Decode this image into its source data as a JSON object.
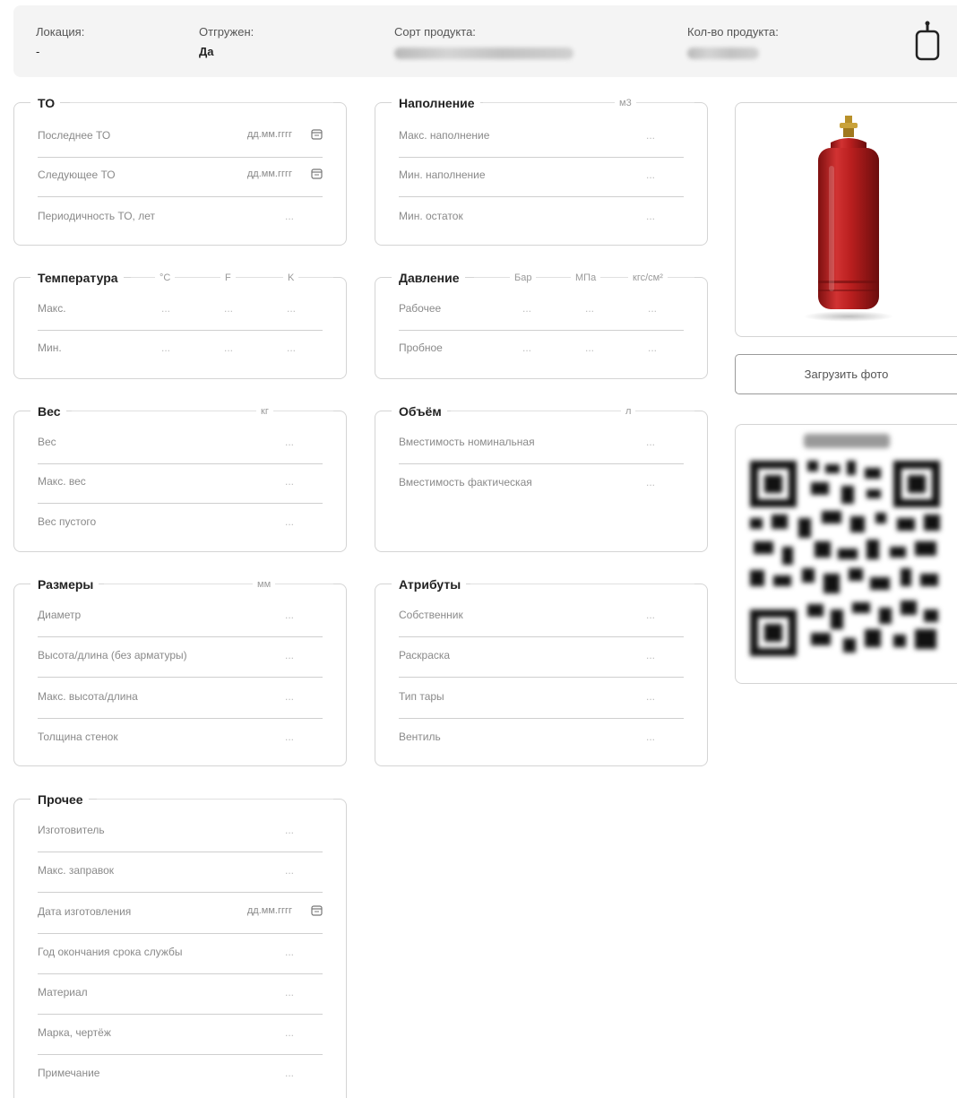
{
  "header": {
    "location_label": "Локация:",
    "location_value": "-",
    "shipped_label": "Отгружен:",
    "shipped_value": "Да",
    "grade_label": "Сорт продукта:",
    "qty_label": "Кол-во продукта:"
  },
  "panels": {
    "to": {
      "title": "ТО",
      "rows": [
        {
          "label": "Последнее ТО",
          "value": "дд.мм.гггг"
        },
        {
          "label": "Следующее ТО",
          "value": "дд.мм.гггг"
        },
        {
          "label": "Периодичность ТО, лет",
          "value": "..."
        }
      ]
    },
    "filling": {
      "title": "Наполнение",
      "unit": "м3",
      "rows": [
        {
          "label": "Макс. наполнение",
          "value": "..."
        },
        {
          "label": "Мин. наполнение",
          "value": "..."
        },
        {
          "label": "Мин. остаток",
          "value": "..."
        }
      ]
    },
    "temperature": {
      "title": "Температура",
      "units": [
        "°C",
        "F",
        "K"
      ],
      "rows": [
        {
          "label": "Макс.",
          "values": [
            "...",
            "...",
            "..."
          ]
        },
        {
          "label": "Мин.",
          "values": [
            "...",
            "...",
            "..."
          ]
        }
      ]
    },
    "pressure": {
      "title": "Давление",
      "units": [
        "Бар",
        "МПа",
        "кгс/см²"
      ],
      "rows": [
        {
          "label": "Рабочее",
          "values": [
            "...",
            "...",
            "..."
          ]
        },
        {
          "label": "Пробное",
          "values": [
            "...",
            "...",
            "..."
          ]
        }
      ]
    },
    "weight": {
      "title": "Вес",
      "unit": "кг",
      "rows": [
        {
          "label": "Вес",
          "value": "..."
        },
        {
          "label": "Макс. вес",
          "value": "..."
        },
        {
          "label": "Вес пустого",
          "value": "..."
        }
      ]
    },
    "volume": {
      "title": "Объём",
      "unit": "л",
      "rows": [
        {
          "label": "Вместимость номинальная",
          "value": "..."
        },
        {
          "label": "Вместимость фактическая",
          "value": "..."
        }
      ]
    },
    "dimensions": {
      "title": "Размеры",
      "unit": "мм",
      "rows": [
        {
          "label": "Диаметр",
          "value": "..."
        },
        {
          "label": "Высота/длина (без арматуры)",
          "value": "..."
        },
        {
          "label": "Макс. высота/длина",
          "value": "..."
        },
        {
          "label": "Толщина стенок",
          "value": "..."
        }
      ]
    },
    "attributes": {
      "title": "Атрибуты",
      "rows": [
        {
          "label": "Собственник",
          "value": "..."
        },
        {
          "label": "Раскраска",
          "value": "..."
        },
        {
          "label": "Тип тары",
          "value": "..."
        },
        {
          "label": "Вентиль",
          "value": "..."
        }
      ]
    },
    "other": {
      "title": "Прочее",
      "rows": [
        {
          "label": "Изготовитель",
          "value": "..."
        },
        {
          "label": "Макс. заправок",
          "value": "..."
        },
        {
          "label": "Дата изготовления",
          "value": "дд.мм.гггг"
        },
        {
          "label": "Год окончания срока службы",
          "value": "..."
        },
        {
          "label": "Материал",
          "value": "..."
        },
        {
          "label": "Марка, чертёж",
          "value": "..."
        },
        {
          "label": "Примечание",
          "value": "..."
        }
      ]
    }
  },
  "upload_label": "Загрузить фото",
  "icons": {
    "cylinder": "cylinder-icon",
    "calendar": "calendar-icon",
    "qr": "qr-code-image"
  },
  "colors": {
    "cylinder_red": "#b91f1f",
    "header_bg": "#f4f4f4",
    "border": "#d4d4d4"
  }
}
